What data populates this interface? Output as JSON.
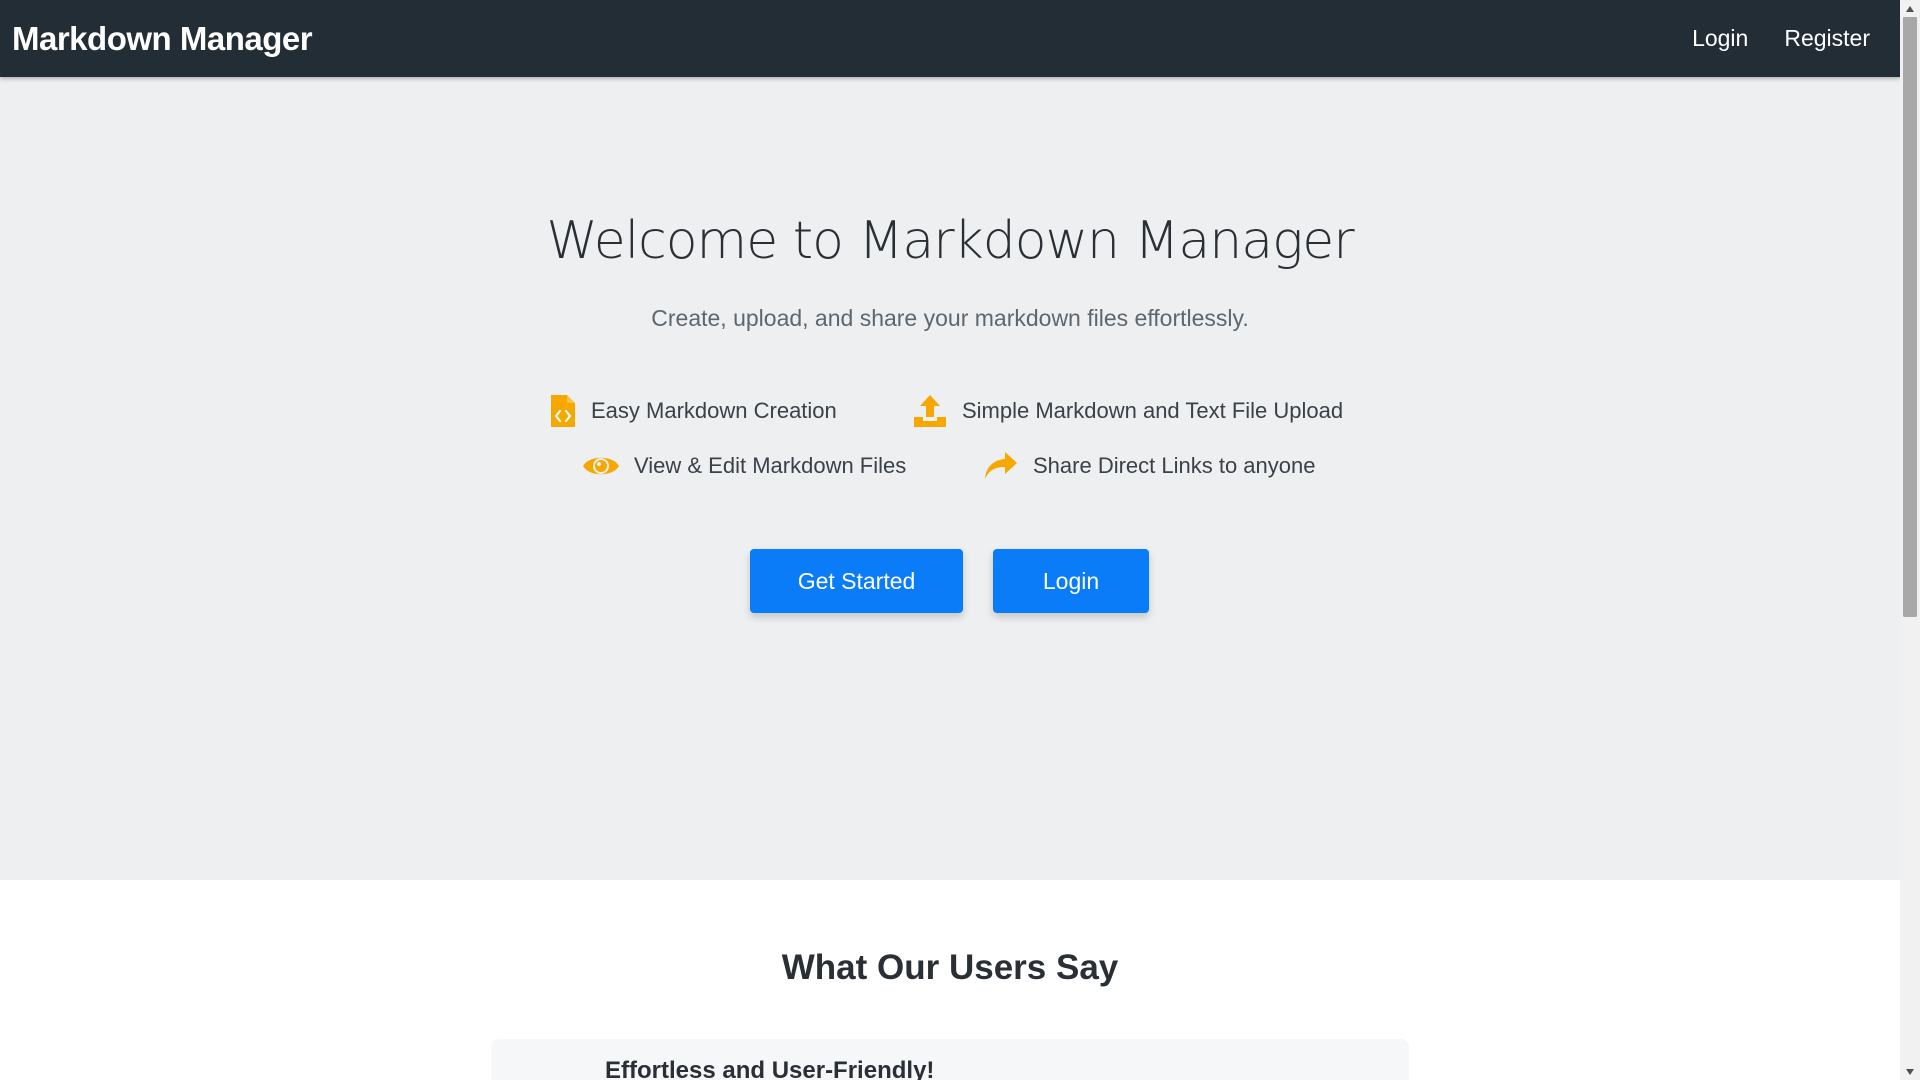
{
  "navbar": {
    "brand": "Markdown Manager",
    "links": [
      {
        "label": "Login"
      },
      {
        "label": "Register"
      }
    ]
  },
  "hero": {
    "title": "Welcome to Markdown Manager",
    "subtitle": "Create, upload, and share your markdown files effortlessly.",
    "features": [
      {
        "label": "Easy Markdown Creation",
        "icon": "file-code-icon"
      },
      {
        "label": "Simple Markdown and Text File Upload",
        "icon": "upload-icon"
      },
      {
        "label": "View & Edit Markdown Files",
        "icon": "eye-icon"
      },
      {
        "label": "Share Direct Links to anyone",
        "icon": "share-icon"
      }
    ],
    "buttons": {
      "get_started": "Get Started",
      "login": "Login"
    }
  },
  "testimonials": {
    "title": "What Our Users Say",
    "first_card_title": "Effortless and User-Friendly!"
  },
  "colors": {
    "navbar_bg": "#232d36",
    "hero_bg": "#edeff1",
    "accent": "#0a7cf7",
    "icon": "#f6a800"
  }
}
